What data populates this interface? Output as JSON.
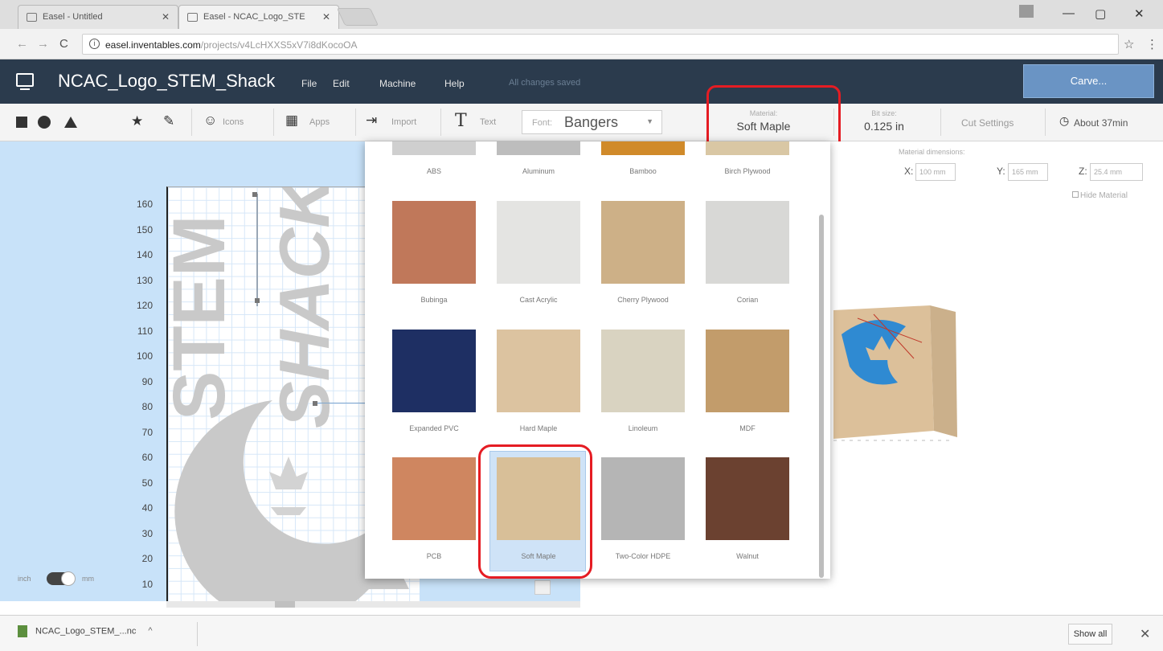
{
  "browser": {
    "tabs": [
      {
        "title": "Easel - Untitled"
      },
      {
        "title": "Easel - NCAC_Logo_STE"
      }
    ],
    "url_host": "easel.inventables.com",
    "url_path": "/projects/v4LcHXXS5xV7i8dKocoOA"
  },
  "header": {
    "project_title": "NCAC_Logo_STEM_Shack",
    "menu": [
      "File",
      "Edit",
      "Machine",
      "Help"
    ],
    "save_status": "All changes saved",
    "carve_label": "Carve..."
  },
  "toolbar": {
    "icons_label": "Icons",
    "apps_label": "Apps",
    "import_label": "Import",
    "text_label": "Text",
    "font_label": "Font:",
    "font_value": "Bangers",
    "material_label": "Material:",
    "material_value": "Soft Maple",
    "bit_size_label": "Bit size:",
    "bit_size_value": "0.125 in",
    "cut_settings_label": "Cut Settings",
    "time_label": "About 37min"
  },
  "canvas": {
    "y_ticks": [
      "160",
      "150",
      "140",
      "130",
      "120",
      "110",
      "100",
      "90",
      "80",
      "70",
      "60",
      "50",
      "40",
      "30",
      "20",
      "10"
    ],
    "units_left": "inch",
    "units_right": "mm"
  },
  "material_dimensions": {
    "label": "Material dimensions:",
    "x_label": "X:",
    "x_value": "100 mm",
    "y_label": "Y:",
    "y_value": "165 mm",
    "z_label": "Z:",
    "z_value": "25.4 mm",
    "hide_label": "Hide Material"
  },
  "materials": [
    {
      "name": "ABS",
      "color": "#cfcfcf"
    },
    {
      "name": "Aluminum",
      "color": "#bdbdbd"
    },
    {
      "name": "Bamboo",
      "color": "#d08a2a"
    },
    {
      "name": "Birch Plywood",
      "color": "#d9c7a4"
    },
    {
      "name": "Bubinga",
      "color": "#c0785a"
    },
    {
      "name": "Cast Acrylic",
      "color": "#e4e4e2"
    },
    {
      "name": "Cherry Plywood",
      "color": "#cdb087"
    },
    {
      "name": "Corian",
      "color": "#d8d8d6"
    },
    {
      "name": "Expanded PVC",
      "color": "#1e2f63"
    },
    {
      "name": "Hard Maple",
      "color": "#dcc3a0"
    },
    {
      "name": "Linoleum",
      "color": "#d9d3c1"
    },
    {
      "name": "MDF",
      "color": "#c29c6b"
    },
    {
      "name": "PCB",
      "color": "#cf8660"
    },
    {
      "name": "Soft Maple",
      "color": "#d8bf98"
    },
    {
      "name": "Two-Color HDPE",
      "color": "#b5b5b5"
    },
    {
      "name": "Walnut",
      "color": "#6b4130"
    }
  ],
  "selected_material": "Soft Maple",
  "download": {
    "filename": "NCAC_Logo_STEM_...nc",
    "show_all": "Show all"
  }
}
